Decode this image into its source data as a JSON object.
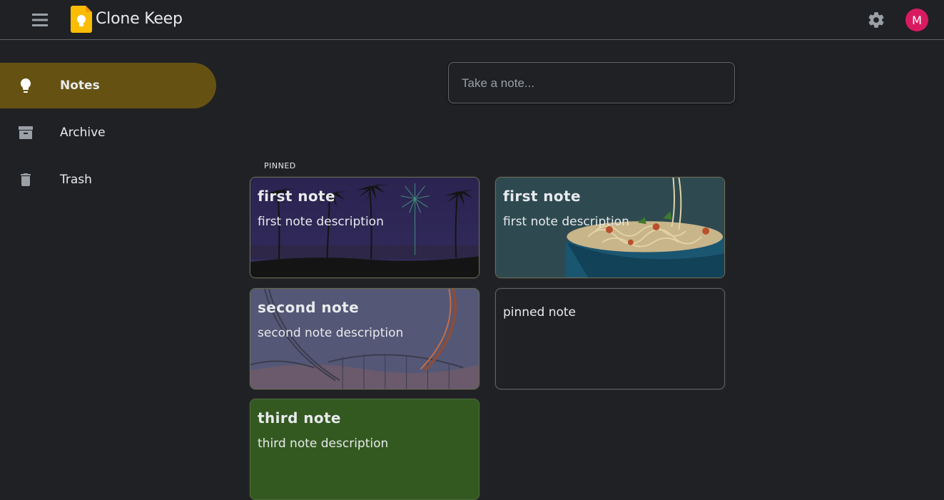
{
  "header": {
    "app_title": "Clone Keep",
    "menu_icon": "hamburger-menu-icon",
    "logo_icon": "keep-lightbulb-logo-icon",
    "settings_icon": "gear-icon",
    "avatar_initial": "M",
    "avatar_color": "#d81b60"
  },
  "sidebar": {
    "items": [
      {
        "label": "Notes",
        "icon": "lightbulb-icon",
        "active": true
      },
      {
        "label": "Archive",
        "icon": "archive-icon",
        "active": false
      },
      {
        "label": "Trash",
        "icon": "trash-icon",
        "active": false
      }
    ],
    "active_color": "#655213"
  },
  "take_note": {
    "placeholder": "Take a note..."
  },
  "sections": {
    "pinned_label": "PINNED"
  },
  "notes": [
    {
      "title": "first note",
      "description": "first note description",
      "background": "night-palms-fireworks"
    },
    {
      "title": "first note",
      "description": "first note description",
      "background": "spaghetti-bowl"
    },
    {
      "title": "second note",
      "description": "second note description",
      "background": "roller-coaster"
    },
    {
      "title": "",
      "description": "pinned note",
      "background": "none"
    },
    {
      "title": "third note",
      "description": "third note description",
      "background": "green"
    }
  ],
  "colors": {
    "app_background": "#202124",
    "text": "#e8eaed",
    "border": "#5f6368"
  }
}
